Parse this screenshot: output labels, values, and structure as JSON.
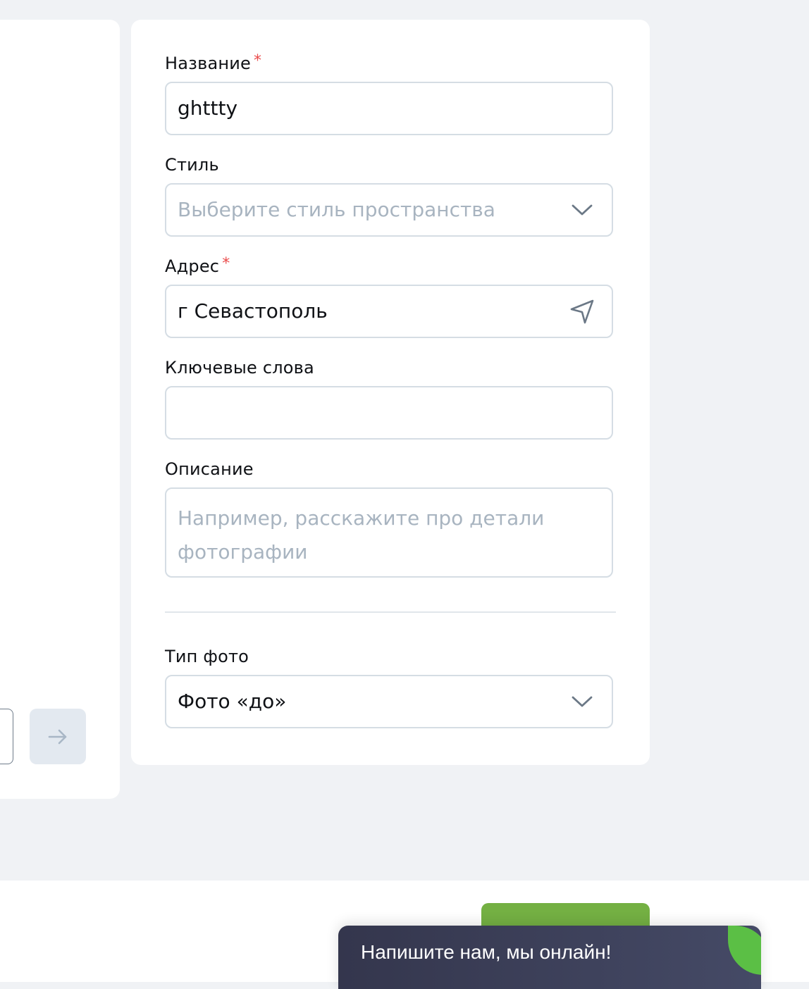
{
  "form": {
    "name": {
      "label": "Название",
      "required_mark": "*",
      "value": "ghttty"
    },
    "style": {
      "label": "Стиль",
      "placeholder": "Выберите стиль пространства"
    },
    "address": {
      "label": "Адрес",
      "required_mark": "*",
      "value": "г Севастополь"
    },
    "keywords": {
      "label": "Ключевые слова",
      "value": ""
    },
    "description": {
      "label": "Описание",
      "placeholder": "Например, расскажите про детали фотографии"
    },
    "photo_type": {
      "label": "Тип фото",
      "value": "Фото «до»"
    }
  },
  "chat": {
    "text": "Напишите нам, мы онлайн!"
  },
  "icons": {
    "next": "arrow-right-icon",
    "style_dropdown": "chevron-down-icon",
    "address_locate": "navigation-arrow-icon",
    "photo_type_dropdown": "chevron-down-icon"
  },
  "colors": {
    "background": "#f0f2f5",
    "required": "#ea4b4b",
    "field_border": "#d5dde4",
    "placeholder": "#a8b4c0",
    "green_button": "#74b043",
    "chat_background": "#3a3d55",
    "chat_accent": "#5bbf45"
  }
}
